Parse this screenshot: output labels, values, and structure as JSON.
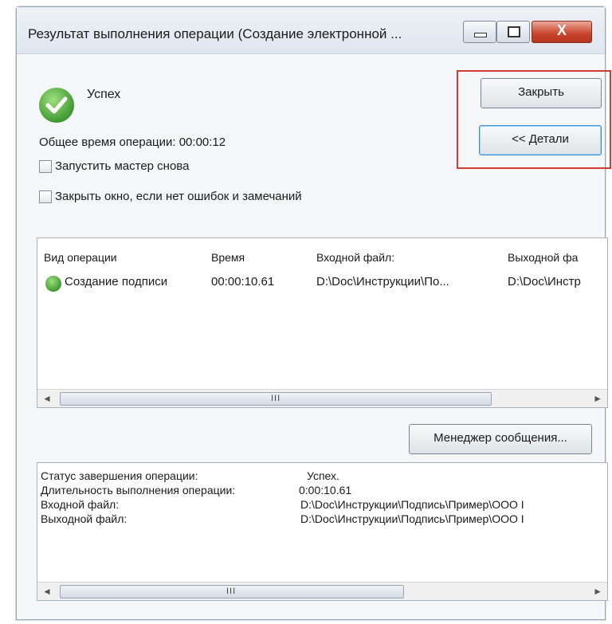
{
  "window": {
    "title": "Результат выполнения операции (Создание электронной ...",
    "close_glyph": "X"
  },
  "status": {
    "label": "Успех",
    "total_time": "Общее время операции: 00:00:12"
  },
  "options": {
    "restart_wizard": "Запустить мастер снова",
    "close_if_no_errors": "Закрыть окно, если нет ошибок и замечаний"
  },
  "buttons": {
    "close": "Закрыть",
    "details": "<< Детали",
    "message_manager": "Менеджер сообщения..."
  },
  "operations": {
    "columns": [
      "Вид операции",
      "Время",
      "Входной файл:",
      "Выходной фа"
    ],
    "rows": [
      {
        "type": "Создание подписи",
        "time": "00:00:10.61",
        "input": "D:\\Doc\\Инструкции\\По...",
        "output": "D:\\Doc\\Инстр"
      }
    ]
  },
  "log": {
    "rows": [
      {
        "label": "Статус завершения операции:",
        "value": "Успех."
      },
      {
        "label": "Длительность выполнения операции:",
        "value": "0:00:10.61"
      },
      {
        "label": "Входной файл:",
        "value": "D:\\Doc\\Инструкции\\Подпись\\Пример\\ООО I"
      },
      {
        "label": "Выходной файл:",
        "value": "D:\\Doc\\Инструкции\\Подпись\\Пример\\ООО I"
      }
    ]
  },
  "scrollbar": {
    "grip": "III",
    "left_arrow": "◄",
    "right_arrow": "►"
  },
  "icons": {
    "success": "check-circle-icon"
  }
}
